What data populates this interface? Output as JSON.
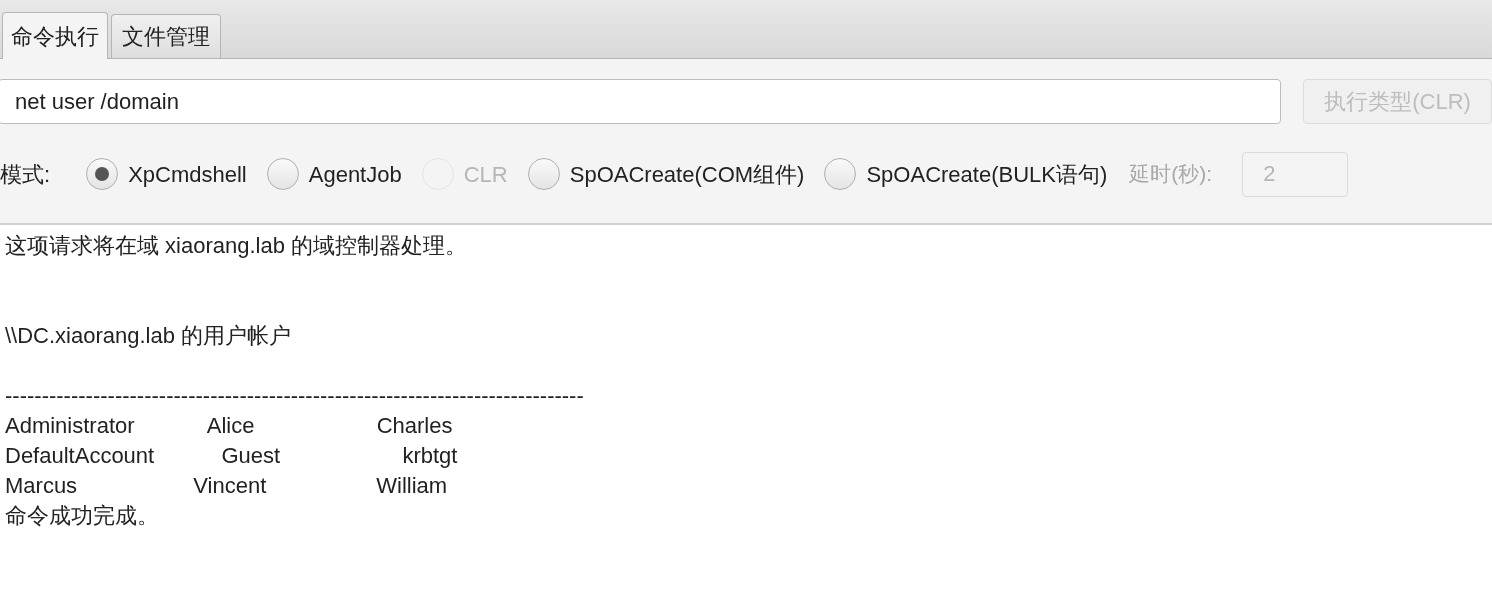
{
  "tabs": [
    {
      "label": "命令执行",
      "selected": true
    },
    {
      "label": "文件管理",
      "selected": false
    }
  ],
  "command": {
    "value": "net user /domain"
  },
  "exec_button": {
    "label": "执行类型(CLR)",
    "disabled": true
  },
  "mode": {
    "label": "模式:",
    "options": [
      {
        "label": "XpCmdshell",
        "selected": true,
        "disabled": false
      },
      {
        "label": "AgentJob",
        "selected": false,
        "disabled": false
      },
      {
        "label": "CLR",
        "selected": false,
        "disabled": true
      },
      {
        "label": "SpOACreate(COM组件)",
        "selected": false,
        "disabled": false
      },
      {
        "label": "SpOACreate(BULK语句)",
        "selected": false,
        "disabled": false
      }
    ]
  },
  "delay": {
    "label": "延时(秒):",
    "value": "2",
    "disabled": true
  },
  "output": {
    "value": "这项请求将在域 xiaorang.lab 的域控制器处理。\n\n\n\\\\DC.xiaorang.lab 的用户帐户\n\n-------------------------------------------------------------------------------\nAdministrator            Alice                    Charles\nDefaultAccount           Guest                    krbtgt\nMarcus                   Vincent                  William\n命令成功完成。"
  }
}
